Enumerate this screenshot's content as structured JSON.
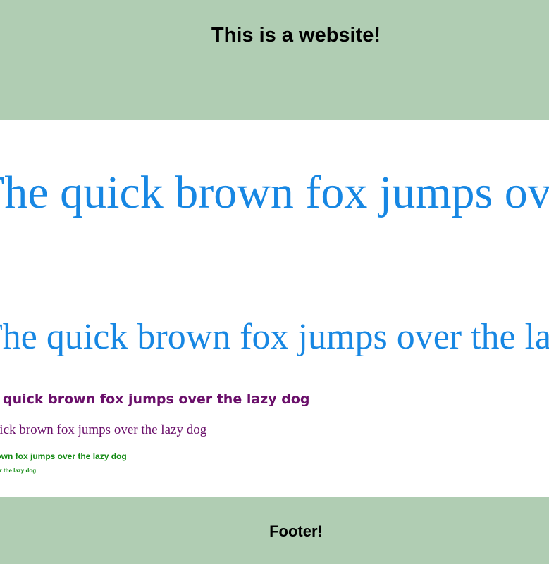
{
  "header": {
    "title": "This is a website!",
    "background_color": "#b0cdb3"
  },
  "content": {
    "lines": [
      {
        "text": "The quick brown fox jumps over the lazy dog",
        "color": "#1787e3"
      },
      {
        "text": "The quick brown fox jumps over the lazy dog",
        "color": "#1787e3"
      },
      {
        "text": "The quick brown fox jumps over the lazy dog",
        "color": "#6a0f6a"
      },
      {
        "text": "The quick brown fox jumps over the lazy dog",
        "color": "#6a0f6a"
      },
      {
        "text": "The quick brown fox jumps over the lazy dog",
        "color": "#138a13"
      },
      {
        "text": "The quick brown fox jumps over the lazy dog",
        "color": "#138a13"
      }
    ]
  },
  "footer": {
    "text": "Footer!",
    "background_color": "#b0cdb3"
  }
}
